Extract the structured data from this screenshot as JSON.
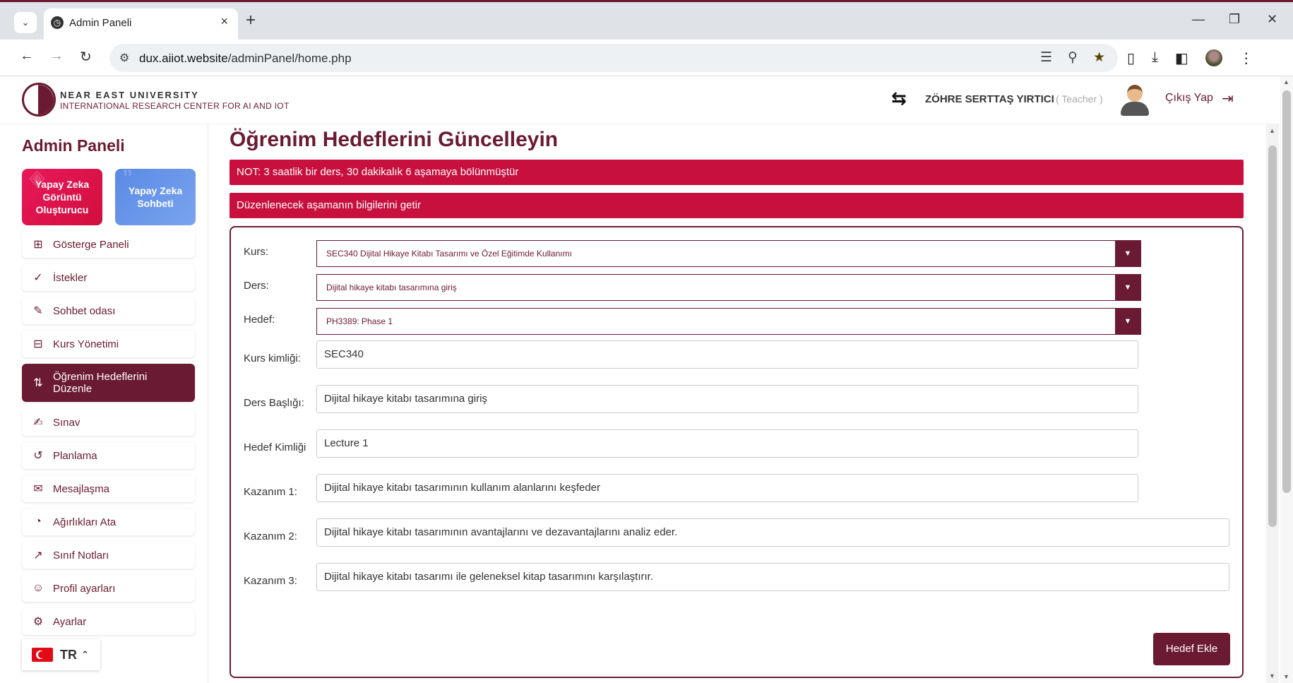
{
  "browser": {
    "tab_title": "Admin Paneli",
    "url_host": "dux.aiiot.website",
    "url_path": "/adminPanel/home.php",
    "icons": [
      "tab-menu-icon",
      "globe-icon",
      "close-icon",
      "plus-icon",
      "minimize-icon",
      "restore-icon",
      "window-close-icon",
      "back-icon",
      "forward-icon",
      "reload-icon",
      "tune-icon",
      "translate-icon",
      "zoom-icon",
      "star-icon",
      "extensions-icon",
      "download-icon",
      "sidepanel-icon",
      "profile-icon",
      "more-icon"
    ]
  },
  "header": {
    "logo_line1": "NEAR EAST UNIVERSITY",
    "logo_line2": "INTERNATIONAL RESEARCH CENTER FOR AI AND IOT",
    "user_name": "ZÖHRE SERTTAŞ YIRTICI",
    "user_role": "( Teacher )",
    "logout_label": "Çıkış Yap"
  },
  "sidebar": {
    "title": "Admin Paneli",
    "cards": [
      {
        "label": "Yapay Zeka Görüntü Oluşturucu",
        "color": "#e8185a"
      },
      {
        "label": "Yapay Zeka Sohbeti",
        "color": "#5a8ae6"
      }
    ],
    "items": [
      {
        "label": "Gösterge Paneli",
        "icon": "dashboard-icon"
      },
      {
        "label": "İstekler",
        "icon": "check-circle-icon"
      },
      {
        "label": "Sohbet odası",
        "icon": "chat-icon"
      },
      {
        "label": "Kurs Yönetimi",
        "icon": "grid-plus-icon"
      },
      {
        "label": "Öğrenim Hedeflerini Düzenle",
        "icon": "sort-icon",
        "active": true
      },
      {
        "label": "Sınav",
        "icon": "pen-circle-icon"
      },
      {
        "label": "Planlama",
        "icon": "history-icon"
      },
      {
        "label": "Mesajlaşma",
        "icon": "message-icon"
      },
      {
        "label": "Ağırlıkları Ata",
        "icon": "pie-chart-icon"
      },
      {
        "label": "Sınıf Notları",
        "icon": "trend-icon"
      },
      {
        "label": "Profil ayarları",
        "icon": "user-icon"
      },
      {
        "label": "Ayarlar",
        "icon": "gear-icon"
      }
    ],
    "language": "TR"
  },
  "main": {
    "title": "Öğrenim Hedeflerini Güncelleyin",
    "note": "NOT: 3 saatlik bir ders, 30 dakikalık 6 aşamaya bölünmüştür",
    "fetch_banner": "Düzenlenecek aşamanın bilgilerini getir",
    "form": {
      "kurs_label": "Kurs:",
      "kurs_value": "SEC340 Dijital Hikaye Kitabı Tasarımı ve Özel Eğitimde Kullanımı",
      "ders_label": "Ders:",
      "ders_value": "Dijital hikaye kitabı tasarımına giriş",
      "hedef_label": "Hedef:",
      "hedef_value": "PH3389: Phase 1",
      "kurs_kimligi_label": "Kurs kimliği:",
      "kurs_kimligi_value": "SEC340",
      "ders_basligi_label": "Ders Başlığı:",
      "ders_basligi_value": "Dijital hikaye kitabı tasarımına giriş",
      "hedef_kimligi_label": "Hedef Kimliği",
      "hedef_kimligi_value": "Lecture 1",
      "kazanim1_label": "Kazanım 1:",
      "kazanim1_value": "Dijital hikaye kitabı tasarımının kullanım alanlarını keşfeder",
      "kazanim2_label": "Kazanım 2:",
      "kazanim2_value": "Dijital hikaye kitabı tasarımının avantajlarını ve dezavantajlarını analiz eder.",
      "kazanim3_label": "Kazanım 3:",
      "kazanim3_value": "Dijital hikaye kitabı tasarımı ile geleneksel kitap tasarımını karşılaştırır.",
      "add_button": "Hedef Ekle"
    }
  },
  "colors": {
    "accent": "#6a1a32",
    "banner": "#c8103e"
  }
}
